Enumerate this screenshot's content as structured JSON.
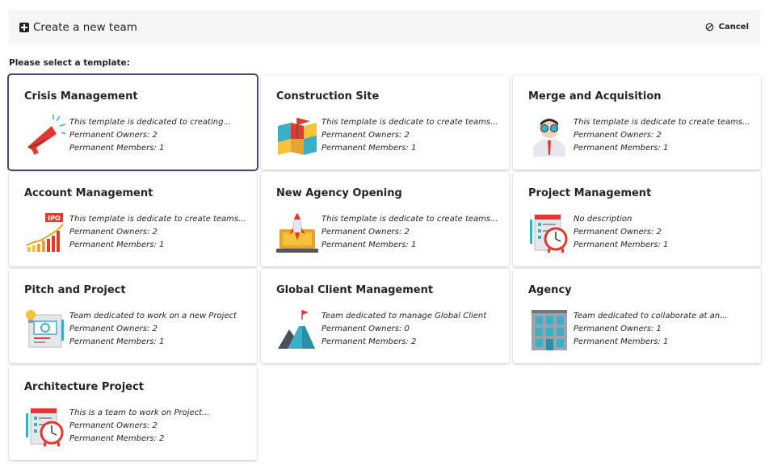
{
  "header": {
    "title": "Create a new team",
    "cancel_label": "Cancel"
  },
  "prompt": "Please select a template:",
  "templates": [
    {
      "title": "Crisis Management",
      "description": "This template is dedicated to creating...",
      "owners": "Permanent Owners: 2",
      "members": "Permanent Members: 1",
      "icon": "megaphone-icon",
      "selected": true
    },
    {
      "title": "Construction Site",
      "description": "This template is dedicate to create teams...",
      "owners": "Permanent Owners: 2",
      "members": "Permanent Members: 1",
      "icon": "map-flag-icon",
      "selected": false
    },
    {
      "title": "Merge and Acquisition",
      "description": "This template is dedicate to create teams...",
      "owners": "Permanent Owners: 2",
      "members": "Permanent Members: 1",
      "icon": "businessman-icon",
      "selected": false
    },
    {
      "title": "Account Management",
      "description": "This template is dedicate to create teams...",
      "owners": "Permanent Owners: 2",
      "members": "Permanent Members: 1",
      "icon": "ipo-chart-icon",
      "selected": false
    },
    {
      "title": "New Agency Opening",
      "description": "This template is dedicate to create teams...",
      "owners": "Permanent Owners: 2",
      "members": "Permanent Members: 1",
      "icon": "rocket-laptop-icon",
      "selected": false
    },
    {
      "title": "Project Management",
      "description": "No description",
      "owners": "Permanent Owners: 2",
      "members": "Permanent Members: 1",
      "icon": "clipboard-clock-icon",
      "selected": false
    },
    {
      "title": "Pitch and Project",
      "description": "Team dedicated to work on a new Project",
      "owners": "Permanent Owners: 2",
      "members": "Permanent Members: 1",
      "icon": "idea-presentation-icon",
      "selected": false
    },
    {
      "title": "Global Client Management",
      "description": "Team dedicated to manage Global Client",
      "owners": "Permanent Owners: 0",
      "members": "Permanent Members: 2",
      "icon": "mountain-flag-icon",
      "selected": false
    },
    {
      "title": "Agency",
      "description": "Team dedicated to collaborate at an...",
      "owners": "Permanent Owners: 1",
      "members": "Permanent Members: 1",
      "icon": "office-building-icon",
      "selected": false
    },
    {
      "title": "Architecture Project",
      "description": "This is a team to work on Project...",
      "owners": "Permanent Owners: 2",
      "members": "Permanent Members: 2",
      "icon": "clipboard-clock-icon",
      "selected": false
    }
  ]
}
